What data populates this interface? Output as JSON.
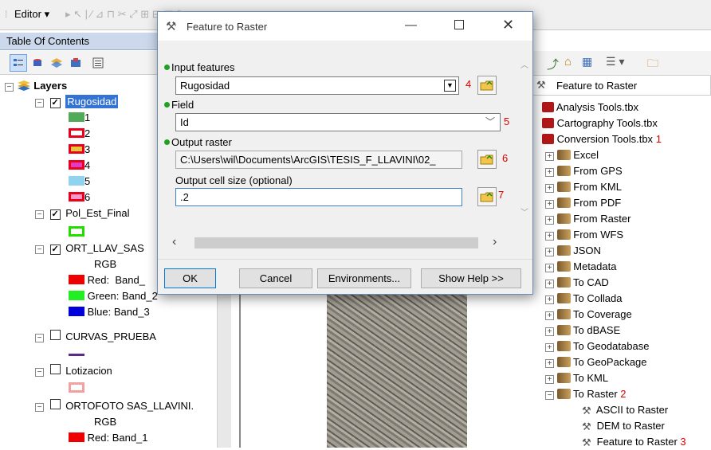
{
  "toolbar": {
    "editor_label": "Editor ▾",
    "gray_icons": "▸ ↖ | ⁄ ⊿ ⊓ ✂ ⤢ ⊞ ⊟ ▣ ✎"
  },
  "toc": {
    "title": "Table Of Contents",
    "layers_label": "Layers",
    "rugosidad": "Rugosidad",
    "classes": [
      {
        "label": "1",
        "color": "#4fab5a",
        "outline": "#4fab5a"
      },
      {
        "label": "2",
        "color": "#ffffff",
        "outline": "#e8001c"
      },
      {
        "label": "3",
        "color": "#e6c73a",
        "outline": "#e8001c"
      },
      {
        "label": "4",
        "color": "#e53abf",
        "outline": "#e8001c"
      },
      {
        "label": "5",
        "color": "#8fd3f0",
        "outline": "#8fd3f0"
      },
      {
        "label": "6",
        "color": "#ff96c8",
        "outline": "#e8001c"
      }
    ],
    "pol": "Pol_Est_Final",
    "ort": "ORT_LLAV_SAS",
    "rgb1": "RGB",
    "red1": "Red:",
    "red1_band": "Band_",
    "green": "Green: Band_2",
    "blue": "Blue:  Band_3",
    "curvas": "CURVAS_PRUEBA",
    "lotiz": "Lotizacion",
    "ortofoto": "ORTOFOTO SAS_LLAVINI.",
    "rgb2": "RGB",
    "red2": "Red:   Band_1",
    "colors": {
      "green_outline": "#22dd00",
      "purple_line": "#5b2a8a",
      "salmon": "#f4a0a0",
      "red": "#ee0000",
      "green": "#22ee22",
      "blue": "#0000dd"
    }
  },
  "catalog": {
    "header": "Feature to Raster",
    "toolboxes": [
      {
        "label": "Analysis Tools.tbx",
        "num": ""
      },
      {
        "label": "Cartography Tools.tbx",
        "num": ""
      },
      {
        "label": "Conversion Tools.tbx",
        "num": "1"
      }
    ],
    "toolsets": [
      "Excel",
      "From GPS",
      "From KML",
      "From PDF",
      "From Raster",
      "From WFS",
      "JSON",
      "Metadata",
      "To CAD",
      "To Collada",
      "To Coverage",
      "To dBASE",
      "To Geodatabase",
      "To GeoPackage",
      "To KML"
    ],
    "to_raster": "To Raster",
    "to_raster_num": "2",
    "tools": [
      {
        "label": "ASCII to Raster",
        "num": ""
      },
      {
        "label": "DEM to Raster",
        "num": ""
      },
      {
        "label": "Feature to Raster",
        "num": "3"
      }
    ]
  },
  "dialog": {
    "title": "Feature to Raster",
    "input_label": "Input features",
    "input_value": "Rugosidad",
    "input_num": "4",
    "field_label": "Field",
    "field_value": "Id",
    "field_num": "5",
    "output_label": "Output raster",
    "output_value": "C:\\Users\\wil\\Documents\\ArcGIS\\TESIS_F_LLAVINI\\02_",
    "output_num": "6",
    "cell_label": "Output cell size (optional)",
    "cell_value": ".2",
    "cell_num": "7",
    "ok": "OK",
    "cancel": "Cancel",
    "env": "Environments...",
    "help": "Show Help >>"
  }
}
